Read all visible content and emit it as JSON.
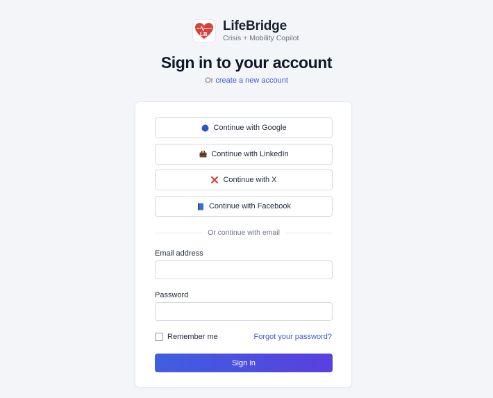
{
  "brand": {
    "name": "LifeBridge",
    "tagline": "Crisis + Mobility Copilot",
    "logo_letters": "LB",
    "logo_color": "#d9403a"
  },
  "heading": {
    "title": "Sign in to your account",
    "or_text": "Or",
    "create_link": "create a new account"
  },
  "social": [
    {
      "label": "Continue with Google",
      "icon": "globe-icon"
    },
    {
      "label": "Continue with LinkedIn",
      "icon": "briefcase-icon"
    },
    {
      "label": "Continue with X",
      "icon": "x-mark-icon"
    },
    {
      "label": "Continue with Facebook",
      "icon": "book-icon"
    }
  ],
  "divider_text": "Or continue with email",
  "form": {
    "email_label": "Email address",
    "email_value": "",
    "password_label": "Password",
    "password_value": "",
    "remember_label": "Remember me",
    "forgot_link": "Forgot your password?",
    "submit_label": "Sign in"
  },
  "colors": {
    "accent": "#3b5bdb",
    "button_gradient_start": "#3f5fe0",
    "button_gradient_end": "#5a3fe0",
    "background": "#f3f5f8"
  }
}
